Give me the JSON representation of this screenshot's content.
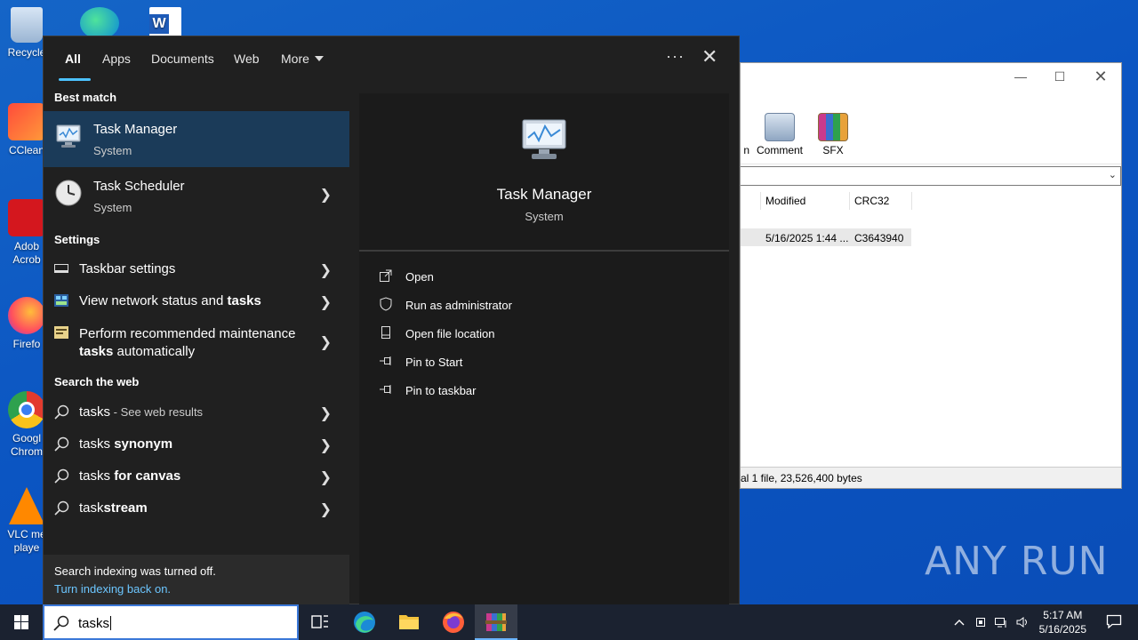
{
  "desktop": {
    "icons": [
      {
        "name": "recycle-bin",
        "label": "Recycle"
      },
      {
        "name": "ccleaner",
        "label": "CClean"
      },
      {
        "name": "adobe-acrobat",
        "label": "Adob\nAcrob"
      },
      {
        "name": "firefox",
        "label": "Firefo"
      },
      {
        "name": "google-chrome",
        "label": "Googl\nChrom"
      },
      {
        "name": "vlc",
        "label": "VLC me\nplaye"
      }
    ]
  },
  "winrar": {
    "toolbar": {
      "partial_label": "n",
      "comment": "Comment",
      "sfx": "SFX"
    },
    "columns": {
      "modified": "Modified",
      "crc": "CRC32"
    },
    "row": {
      "modified": "5/16/2025 1:44 ...",
      "crc": "C3643940"
    },
    "status": "al 1 file, 23,526,400 bytes"
  },
  "search": {
    "tabs": {
      "all": "All",
      "apps": "Apps",
      "documents": "Documents",
      "web": "Web",
      "more": "More"
    },
    "best_match_header": "Best match",
    "best_match": {
      "title": "Task Manager",
      "subtitle": "System"
    },
    "second": {
      "title": "Task Scheduler",
      "subtitle": "System"
    },
    "settings_header": "Settings",
    "settings": [
      {
        "pre": "Taskbar settings",
        "bold": "",
        "post": ""
      },
      {
        "pre": "View network status and ",
        "bold": "tasks",
        "post": ""
      },
      {
        "pre": "Perform recommended maintenance",
        "bold": "tasks",
        "post": " automatically"
      }
    ],
    "web_header": "Search the web",
    "web": [
      {
        "pre": "tasks",
        "bold": "",
        "hint": " - See web results"
      },
      {
        "pre": "tasks ",
        "bold": "synonym",
        "hint": ""
      },
      {
        "pre": "tasks ",
        "bold": "for canvas",
        "hint": ""
      },
      {
        "pre": "task",
        "bold": "stream",
        "hint": ""
      }
    ],
    "notice": {
      "line1": "Search indexing was turned off.",
      "link": "Turn indexing back on."
    },
    "preview": {
      "title": "Task Manager",
      "subtitle": "System",
      "actions": [
        "Open",
        "Run as administrator",
        "Open file location",
        "Pin to Start",
        "Pin to taskbar"
      ]
    }
  },
  "taskbar": {
    "search_value": "tasks",
    "time": "5:17 AM",
    "date": "5/16/2025"
  },
  "watermark": "ANY RUN"
}
